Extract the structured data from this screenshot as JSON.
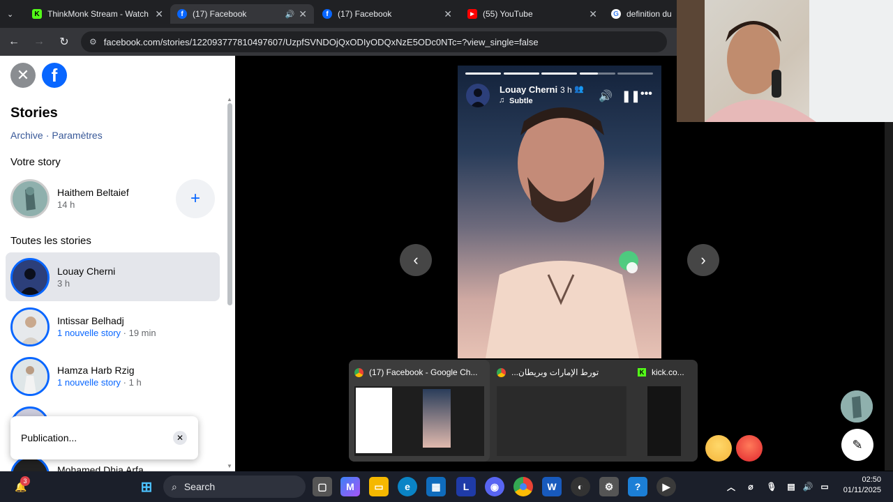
{
  "browser": {
    "tabs": [
      {
        "title": "ThinkMonk Stream - Watch l",
        "favicon": "kick-icon",
        "active": false
      },
      {
        "title": "(17) Facebook",
        "favicon": "facebook-icon",
        "active": true,
        "audio": true
      },
      {
        "title": "(17) Facebook",
        "favicon": "facebook-icon",
        "active": false
      },
      {
        "title": "(55) YouTube",
        "favicon": "youtube-icon",
        "active": false
      },
      {
        "title": "definition du te",
        "favicon": "google-icon",
        "active": false
      }
    ],
    "url": "facebook.com/stories/122093777810497607/UzpfSVNDOjQxODIyODQxNzE5ODc0NTc=?view_single=false"
  },
  "sidebar": {
    "title": "Stories",
    "archive_link": "Archive",
    "separator": "·",
    "settings_link": "Paramètres",
    "your_story_heading": "Votre story",
    "your_story": {
      "name": "Haithem Beltaief",
      "time": "14 h"
    },
    "all_stories_heading": "Toutes les stories",
    "stories": [
      {
        "name": "Louay Cherni",
        "sub": "3 h",
        "selected": true
      },
      {
        "name": "Intissar Belhadj",
        "sub_new": "1 nouvelle story",
        "sub_time": " · 19 min"
      },
      {
        "name": "Hamza Harb Rzig",
        "sub_new": "1 nouvelle story",
        "sub_time": " · 1 h"
      },
      {
        "name": "Mohamed Dhia Arfa",
        "sub": ""
      }
    ],
    "toast": {
      "text": "Publication..."
    }
  },
  "story": {
    "author": "Louay Cherni",
    "time": "3 h",
    "music": "Subtle",
    "progress": [
      1,
      1,
      1,
      0.5,
      0
    ]
  },
  "thumbnails": [
    {
      "title": "(17) Facebook - Google Ch...",
      "icon": "chrome-icon"
    },
    {
      "title": "...تورط الإمارات وبريطان",
      "icon": "chrome-icon"
    },
    {
      "title": "kick.co...",
      "icon": "kick-icon"
    }
  ],
  "taskbar": {
    "search_label": "Search",
    "notification_badge": "3",
    "time": "02:50",
    "date": "01/11/2025"
  },
  "colors": {
    "facebook_blue": "#0866ff",
    "tab_bg": "#202124",
    "toolbar_bg": "#35363a"
  }
}
